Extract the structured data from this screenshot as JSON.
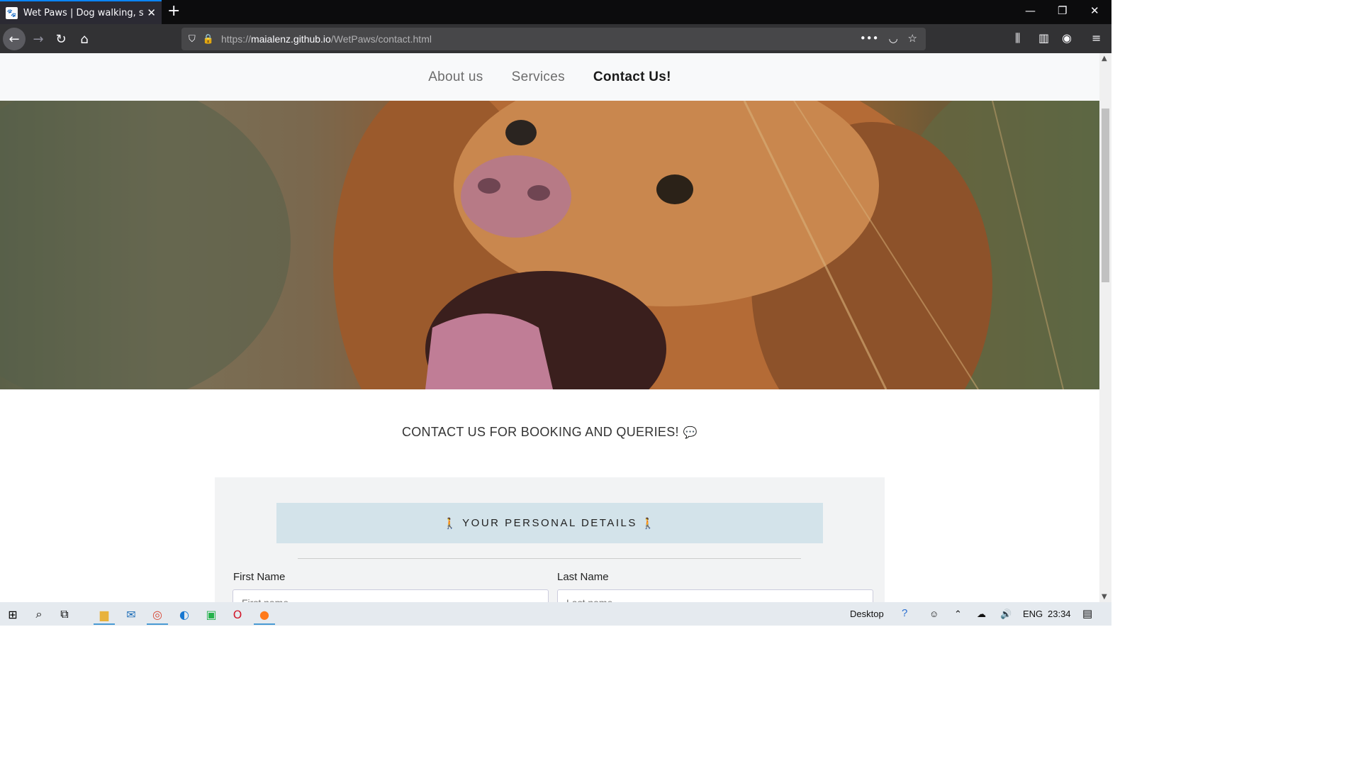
{
  "browser": {
    "tab_title": "Wet Paws | Dog walking, sitting",
    "url_scheme": "https://",
    "url_host": "maialenz.github.io",
    "url_path": "/WetPaws/contact.html"
  },
  "nav": {
    "items": [
      {
        "label": "About us",
        "active": false
      },
      {
        "label": "Services",
        "active": false
      },
      {
        "label": "Contact Us!",
        "active": true
      }
    ]
  },
  "hero": {
    "icon": "dog-photo"
  },
  "contact": {
    "heading": "CONTACT US FOR BOOKING AND QUERIES!",
    "heading_icon": "chat-icon"
  },
  "form": {
    "section_title": "YOUR PERSONAL DETAILS",
    "first_name_label": "First Name",
    "first_name_placeholder": "First name",
    "last_name_label": "Last Name",
    "last_name_placeholder": "Last name"
  },
  "taskbar": {
    "desktop_label": "Desktop",
    "language": "ENG",
    "time": "23:34"
  },
  "colors": {
    "banner_bg": "#d3e3ea",
    "form_bg": "#f2f3f4",
    "nav_bg": "#f8f9fa",
    "accent": "#0a84ff"
  }
}
